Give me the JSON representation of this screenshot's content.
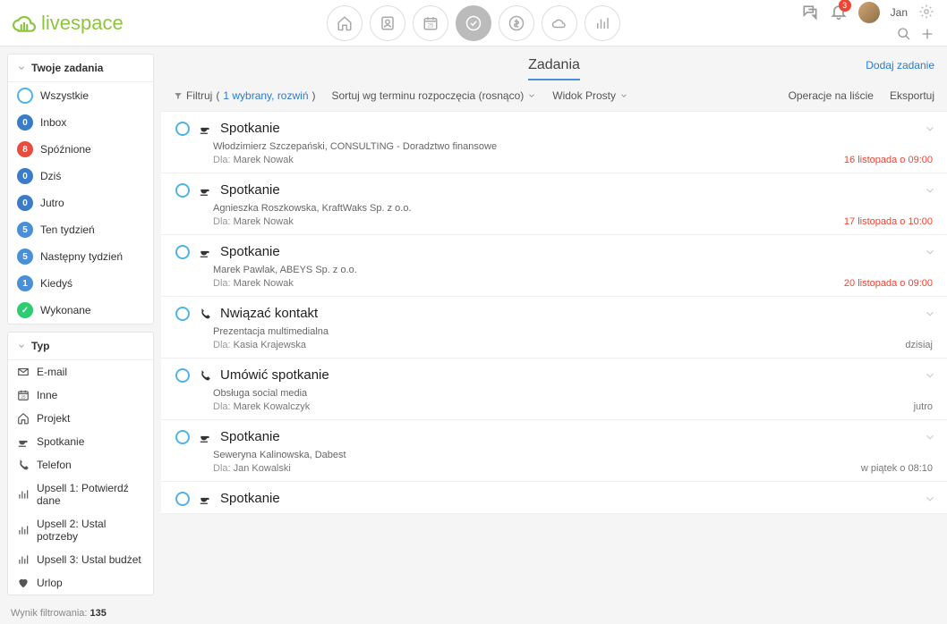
{
  "brand": "livespace",
  "user": {
    "name": "Jan",
    "notif_count": "3"
  },
  "page_title": "Zadania",
  "add_task": "Dodaj zadanie",
  "toolbar": {
    "filter": "Filtruj",
    "filter_sel": "1 wybrany, rozwiń",
    "sort": "Sortuj wg terminu rozpoczęcia (rosnąco)",
    "view": "Widok Prosty",
    "ops": "Operacje na liście",
    "export": "Eksportuj"
  },
  "sidebar": {
    "tasks_header": "Twoje zadania",
    "items": [
      {
        "label": "Wszystkie",
        "badge": "",
        "cls": "b-outline"
      },
      {
        "label": "Inbox",
        "badge": "0",
        "cls": "b-zero"
      },
      {
        "label": "Spóźnione",
        "badge": "8",
        "cls": "b-red"
      },
      {
        "label": "Dziś",
        "badge": "0",
        "cls": "b-zero"
      },
      {
        "label": "Jutro",
        "badge": "0",
        "cls": "b-zero"
      },
      {
        "label": "Ten tydzień",
        "badge": "5",
        "cls": "b-blue"
      },
      {
        "label": "Następny tydzień",
        "badge": "5",
        "cls": "b-blue"
      },
      {
        "label": "Kiedyś",
        "badge": "1",
        "cls": "b-blue"
      },
      {
        "label": "Wykonane",
        "badge": "✓",
        "cls": "b-green"
      }
    ],
    "type_header": "Typ",
    "types": [
      {
        "label": "E-mail",
        "icon": "mail"
      },
      {
        "label": "Inne",
        "icon": "cal"
      },
      {
        "label": "Projekt",
        "icon": "home"
      },
      {
        "label": "Spotkanie",
        "icon": "cup"
      },
      {
        "label": "Telefon",
        "icon": "phone"
      },
      {
        "label": "Upsell 1: Potwierdź dane",
        "icon": "bars"
      },
      {
        "label": "Upsell 2: Ustal potrzeby",
        "icon": "bars"
      },
      {
        "label": "Upsell 3: Ustal budżet",
        "icon": "bars"
      },
      {
        "label": "Urlop",
        "icon": "heart"
      }
    ],
    "filter_label": "Wynik filtrowania:",
    "filter_count": "135"
  },
  "tasks": [
    {
      "icon": "cup",
      "title": "Spotkanie",
      "sub": "Włodzimierz Szczepański, CONSULTING - Doradztwo finansowe",
      "for": "Marek Nowak",
      "date": "16 listopada o 09:00",
      "red": true
    },
    {
      "icon": "cup",
      "title": "Spotkanie",
      "sub": "Agnieszka Roszkowska, KraftWaks Sp. z o.o.",
      "for": "Marek Nowak",
      "date": "17 listopada o 10:00",
      "red": true
    },
    {
      "icon": "cup",
      "title": "Spotkanie",
      "sub": "Marek Pawlak, ABEYS Sp. z o.o.",
      "for": "Marek Nowak",
      "date": "20 listopada o 09:00",
      "red": true
    },
    {
      "icon": "phone",
      "title": "Nwiązać kontakt",
      "sub": "Prezentacja multimedialna",
      "for": "Kasia Krajewska",
      "date": "dzisiaj",
      "red": false
    },
    {
      "icon": "phone",
      "title": "Umówić spotkanie",
      "sub": "Obsługa social media",
      "for": "Marek Kowalczyk",
      "date": "jutro",
      "red": false
    },
    {
      "icon": "cup",
      "title": "Spotkanie",
      "sub": "Seweryna Kalinowska, Dabest",
      "for": "Jan Kowalski",
      "date": "w piątek o 08:10",
      "red": false
    },
    {
      "icon": "cup",
      "title": "Spotkanie",
      "sub": "",
      "for": "",
      "date": "",
      "red": false
    }
  ],
  "for_label": "Dla:"
}
